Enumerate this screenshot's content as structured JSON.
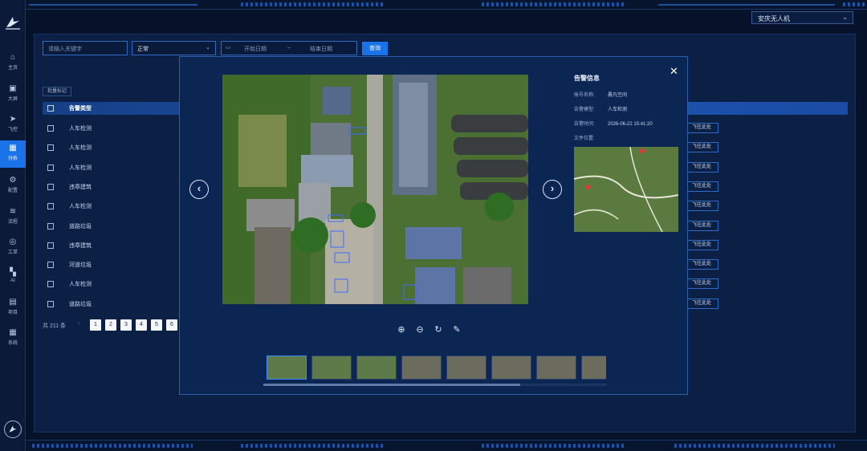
{
  "region_select": {
    "value": "安庆无人机"
  },
  "sidebar": {
    "items": [
      {
        "label": "主页",
        "icon": "home-icon"
      },
      {
        "label": "大屏",
        "icon": "screen-icon"
      },
      {
        "label": "飞控",
        "icon": "flight-control-icon"
      },
      {
        "label": "分析",
        "icon": "analysis-icon"
      },
      {
        "label": "配置",
        "icon": "config-icon"
      },
      {
        "label": "流程",
        "icon": "flow-icon"
      },
      {
        "label": "工单",
        "icon": "workorder-icon"
      },
      {
        "label": "AI",
        "icon": "ai-icon"
      },
      {
        "label": "项目",
        "icon": "project-icon"
      },
      {
        "label": "系统",
        "icon": "system-icon"
      }
    ],
    "active_index": 3
  },
  "filters": {
    "keyword_placeholder": "请输入关键字",
    "status_value": "正常",
    "start_date_placeholder": "开始日期",
    "date_separator": "–",
    "end_date_placeholder": "结束日期",
    "query_label": "查询"
  },
  "table": {
    "batch_label": "批量标记",
    "header_type": "告警类型",
    "rows": [
      "人车检测",
      "人车检测",
      "人车检测",
      "违章建筑",
      "人车检测",
      "道路垃圾",
      "违章建筑",
      "河道垃圾",
      "人车检测",
      "道路垃圾"
    ],
    "goto_label": "飞往此处"
  },
  "pager": {
    "total": "共 211 条",
    "prev": "‹",
    "pages": [
      "1",
      "2",
      "3",
      "4",
      "5",
      "6"
    ],
    "current": "1"
  },
  "modal": {
    "close": "✕",
    "prev_arrow": "‹",
    "next_arrow": "›",
    "info_title": "告警信息",
    "fields": [
      {
        "key": "账号名称:",
        "value": "晨凡空间"
      },
      {
        "key": "告警模型:",
        "value": "人车检测"
      },
      {
        "key": "告警时间:",
        "value": "2026-06-22 15:41:20"
      },
      {
        "key": "文件位置:",
        "value": ""
      }
    ],
    "tools": [
      "zoom-in-icon",
      "zoom-out-icon",
      "rotate-icon",
      "edit-icon"
    ],
    "thumbnail_count": 8,
    "selected_thumbnail": 0
  },
  "colors": {
    "accent": "#1a73e8",
    "bg": "#06122a",
    "panel": "#0c1f45",
    "modal": "#0c2653"
  }
}
